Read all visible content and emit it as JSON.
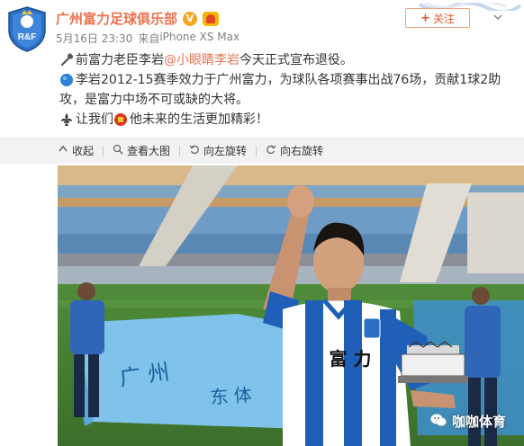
{
  "post": {
    "author": "广州富力足球俱乐部",
    "verified_mark": "V",
    "follow_label": "关注",
    "timestamp": "5月16日 23:30",
    "source_prefix": "来自",
    "source": "iPhone XS Max",
    "avatar_text": "R&F",
    "text": {
      "line1_a": "前富力老臣李岩",
      "line1_mention": "@小眼睛李岩",
      "line1_b": " 今天正式宣布退役。",
      "line2_a": "李岩2012-15赛季效力于广州富力，为球队各项赛事出战76场，贡献1球2助",
      "line3": "攻，是富力中场不可或缺的大将。",
      "line4_a": "让我们",
      "line4_b": "他未来的生活更加精彩！"
    }
  },
  "actions": [
    {
      "label": "收起",
      "icon": "collapse-icon"
    },
    {
      "label": "查看大图",
      "icon": "zoom-icon"
    },
    {
      "label": "向左旋转",
      "icon": "rotate-left-icon"
    },
    {
      "label": "向右旋转",
      "icon": "rotate-right-icon"
    }
  ],
  "photo": {
    "jersey_text": "富 力",
    "watermark": "咖咖体育"
  },
  "colors": {
    "author": "#eb7350",
    "mention": "#eb7350",
    "follow": "#e5542e",
    "action_bar": "#f2f2f5",
    "jersey_blue": "#1f5fb8"
  }
}
